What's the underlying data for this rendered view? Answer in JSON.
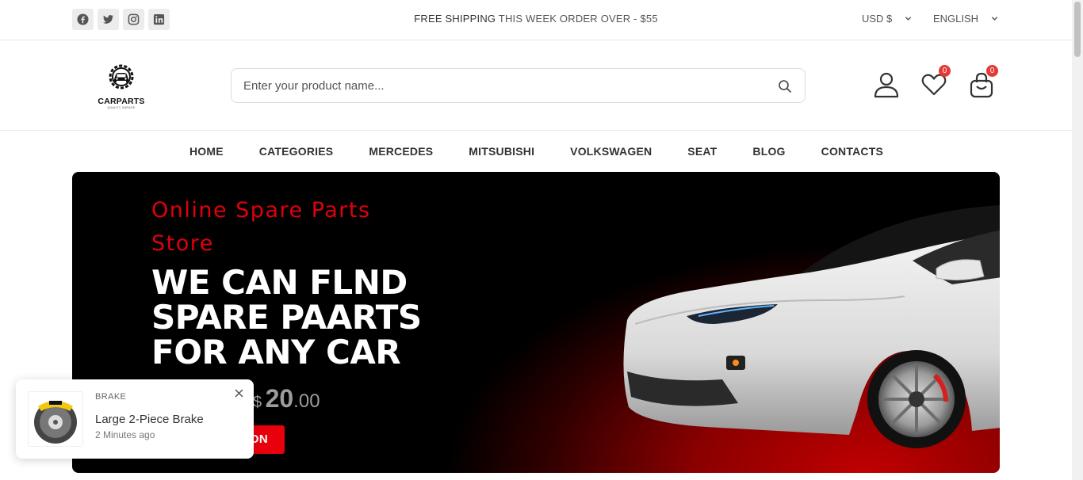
{
  "topbar": {
    "socials": [
      "facebook-icon",
      "twitter-icon",
      "instagram-icon",
      "linkedin-icon"
    ],
    "promo_strong": "FREE SHIPPING",
    "promo_rest": " THIS WEEK ORDER OVER - $55",
    "currency": "USD $",
    "language": "ENGLISH"
  },
  "header": {
    "logo_text": "CARPARTS",
    "logo_sub": "QUALITY GARAGE",
    "search_placeholder": "Enter your product name...",
    "wishlist_count": "0",
    "cart_count": "0"
  },
  "nav": {
    "items": [
      "HOME",
      "CATEGORIES",
      "MERCEDES",
      "MITSUBISHI",
      "VOLKSWAGEN",
      "SEAT",
      "BLOG",
      "CONTACTS"
    ]
  },
  "hero": {
    "subtitle": "Online Spare Parts Store",
    "title_line1": "WE CAN FLND",
    "title_line2": "SPARE PAARTS",
    "title_line3": "FOR ANY CAR",
    "price_currency": "$",
    "price_whole": "20",
    "price_cents": ".00",
    "cta_visible": "ON"
  },
  "toast": {
    "category": "BRAKE",
    "product": "Large 2-Piece Brake",
    "time": "2 Minutes ago"
  },
  "colors": {
    "accent_red": "#e8000d",
    "badge_red": "#e53935"
  }
}
